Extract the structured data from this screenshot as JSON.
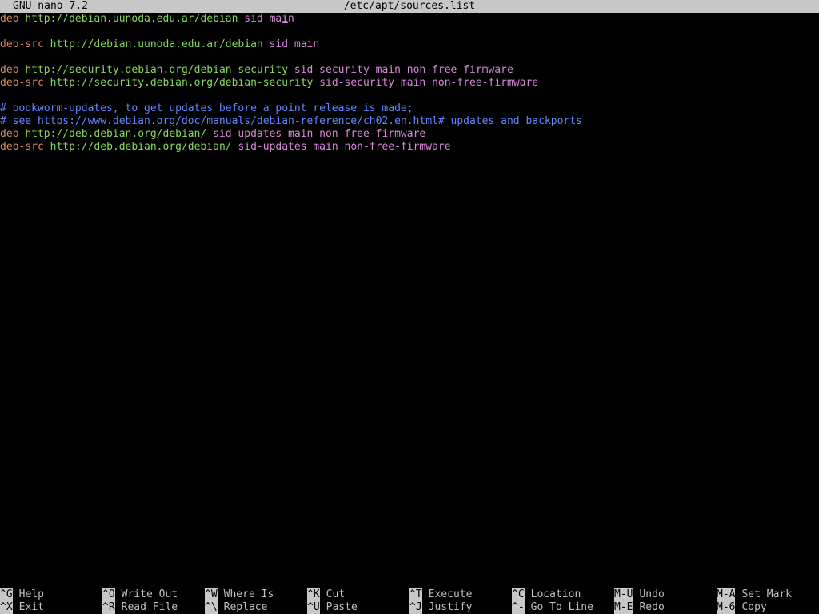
{
  "titlebar": {
    "app": "GNU nano 7.2",
    "file": "/etc/apt/sources.list"
  },
  "lines": [
    {
      "kw": "deb",
      "url": "http://debian.uunoda.edu.ar/debian",
      "suite": "sid",
      "comps_pre": "ma",
      "cursor_char": "i",
      "comps_post": "n"
    },
    {
      "kw": "deb-src",
      "url": "http://debian.uunoda.edu.ar/debian",
      "suite": "sid",
      "comps": "main"
    },
    {
      "kw": "deb",
      "url": "http://security.debian.org/debian-security",
      "suite": "sid-security",
      "comps": "main non-free-firmware"
    },
    {
      "kw": "deb-src",
      "url": "http://security.debian.org/debian-security",
      "suite": "sid-security",
      "comps": "main non-free-firmware"
    },
    {
      "comment": "# bookworm-updates, to get updates before a point release is made;"
    },
    {
      "comment": "# see https://www.debian.org/doc/manuals/debian-reference/ch02.en.html#_updates_and_backports"
    },
    {
      "kw": "deb",
      "url": "http://deb.debian.org/debian/",
      "suite": "sid-updates",
      "comps": "main non-free-firmware"
    },
    {
      "kw": "deb-src",
      "url": "http://deb.debian.org/debian/",
      "suite": "sid-updates",
      "comps": "main non-free-firmware"
    }
  ],
  "shortcuts": [
    {
      "key": "^G",
      "label": "Help"
    },
    {
      "key": "^X",
      "label": "Exit"
    },
    {
      "key": "^O",
      "label": "Write Out"
    },
    {
      "key": "^R",
      "label": "Read File"
    },
    {
      "key": "^W",
      "label": "Where Is"
    },
    {
      "key": "^\\",
      "label": "Replace"
    },
    {
      "key": "^K",
      "label": "Cut"
    },
    {
      "key": "^U",
      "label": "Paste"
    },
    {
      "key": "^T",
      "label": "Execute"
    },
    {
      "key": "^J",
      "label": "Justify"
    },
    {
      "key": "^C",
      "label": "Location"
    },
    {
      "key": "^-",
      "label": "Go To Line"
    },
    {
      "key": "M-U",
      "label": "Undo"
    },
    {
      "key": "M-E",
      "label": "Redo"
    },
    {
      "key": "M-A",
      "label": "Set Mark"
    },
    {
      "key": "M-6",
      "label": "Copy"
    }
  ],
  "colors": {
    "keyword": "#d7875f",
    "url": "#87d75f",
    "suite": "#d787d7",
    "comment": "#5f87ff",
    "bar_bg": "#c8c8c8",
    "background": "#000000"
  }
}
